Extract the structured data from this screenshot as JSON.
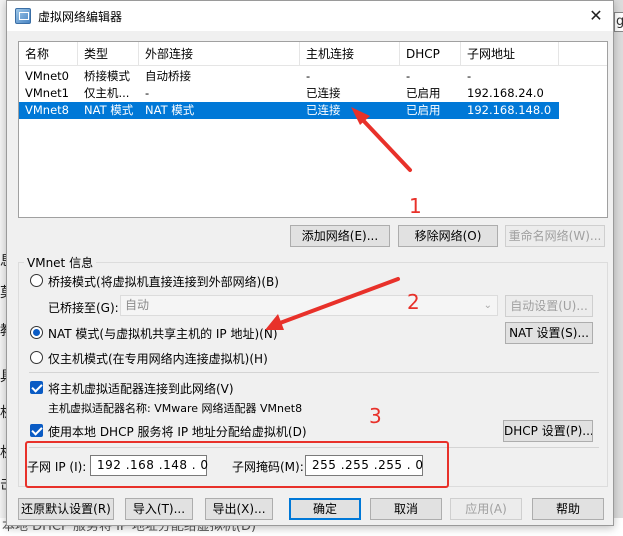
{
  "window": {
    "title": "虚拟网络编辑器",
    "close_glyph": "✕"
  },
  "background": {
    "left_chars": [
      "息",
      "莫",
      "教",
      "具",
      "机",
      "机",
      "击"
    ],
    "bottom_text": "本地 DHCP 服务将 IP 地址分配给虚拟机(D)",
    "top_right_char": "g"
  },
  "network_table": {
    "columns": [
      "名称",
      "类型",
      "外部连接",
      "主机连接",
      "DHCP",
      "子网地址"
    ],
    "rows": [
      {
        "name": "VMnet0",
        "type": "桥接模式",
        "external": "自动桥接",
        "host": "-",
        "dhcp": "-",
        "subnet": "-",
        "selected": false
      },
      {
        "name": "VMnet1",
        "type": "仅主机...",
        "external": "-",
        "host": "已连接",
        "dhcp": "已启用",
        "subnet": "192.168.24.0",
        "selected": false
      },
      {
        "name": "VMnet8",
        "type": "NAT 模式",
        "external": "NAT 模式",
        "host": "已连接",
        "dhcp": "已启用",
        "subnet": "192.168.148.0",
        "selected": true
      }
    ]
  },
  "list_buttons": {
    "add": "添加网络(E)...",
    "remove": "移除网络(O)",
    "rename": "重命名网络(W)..."
  },
  "vmnet_info": {
    "group_title": "VMnet 信息",
    "bridge_radio": "桥接模式(将虚拟机直接连接到外部网络)(B)",
    "bridged_to_label": "已桥接至(G):",
    "bridged_to_value": "自动",
    "auto_settings_button": "自动设置(U)...",
    "nat_radio": "NAT 模式(与虚拟机共享主机的 IP 地址)(N)",
    "nat_settings_button": "NAT 设置(S)...",
    "host_only_radio": "仅主机模式(在专用网络内连接虚拟机)(H)",
    "selected_mode": "nat",
    "connect_adapter_checkbox": "将主机虚拟适配器连接到此网络(V)",
    "connect_adapter_checked": true,
    "adapter_name_label": "主机虚拟适配器名称: VMware 网络适配器 VMnet8",
    "dhcp_checkbox": "使用本地 DHCP 服务将 IP 地址分配给虚拟机(D)",
    "dhcp_checked": true,
    "dhcp_settings_button": "DHCP 设置(P)...",
    "subnet_ip_label": "子网 IP (I):",
    "subnet_ip_value": "192 .168 .148 . 0",
    "subnet_mask_label": "子网掩码(M):",
    "subnet_mask_value": "255 .255 .255 . 0"
  },
  "footer_buttons": {
    "restore_defaults": "还原默认设置(R)",
    "import": "导入(T)...",
    "export": "导出(X)...",
    "ok": "确定",
    "cancel": "取消",
    "apply": "应用(A)",
    "help": "帮助"
  },
  "annotations": {
    "label_1": "1",
    "label_2": "2",
    "label_3": "3",
    "color": "#e8312a"
  },
  "colors": {
    "selection": "#0078d7",
    "annotation": "#e8312a",
    "dialog_bg": "#f0f0f0"
  }
}
